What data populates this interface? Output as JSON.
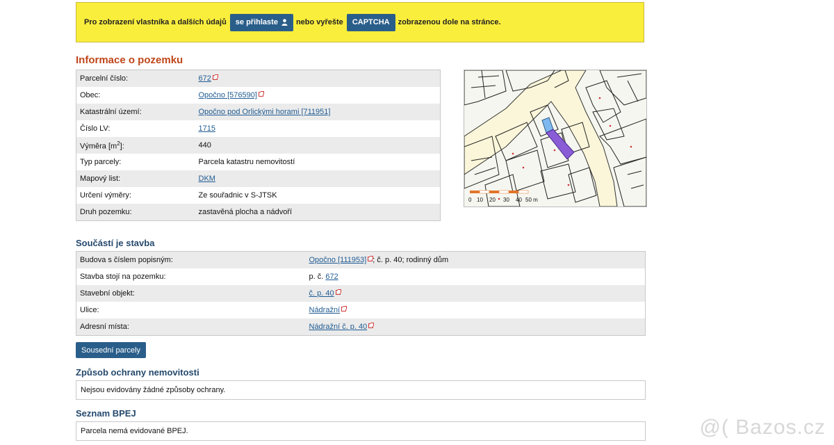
{
  "banner": {
    "text_before": "Pro zobrazení vlastníka a dalších údajů",
    "login_button": "se přihlaste",
    "text_middle": "nebo vyřešte",
    "captcha_button": "CAPTCHA",
    "text_after": "zobrazenou dole na stránce."
  },
  "parcel": {
    "title": "Informace o pozemku",
    "rows": [
      {
        "label": "Parcelní číslo:",
        "value": "672",
        "link": true,
        "ext": true
      },
      {
        "label": "Obec:",
        "value": "Opočno [576590]",
        "link": true,
        "ext": true
      },
      {
        "label": "Katastrální území:",
        "value": "Opočno pod Orlickými horami [711951]",
        "link": true,
        "ext": false
      },
      {
        "label": "Číslo LV:",
        "value": "1715",
        "link": true,
        "ext": false
      },
      {
        "label": "Výměra [m2]:",
        "value": "440",
        "link": false,
        "ext": false
      },
      {
        "label": "Typ parcely:",
        "value": "Parcela katastru nemovitostí",
        "link": false,
        "ext": false
      },
      {
        "label": "Mapový list:",
        "value": "DKM",
        "link": true,
        "ext": false
      },
      {
        "label": "Určení výměry:",
        "value": "Ze souřadnic v S-JTSK",
        "link": false,
        "ext": false
      },
      {
        "label": "Druh pozemku:",
        "value": "zastavěná plocha a nádvoří",
        "link": false,
        "ext": false
      }
    ],
    "area_label_base": "Výměra [m",
    "area_label_sup": "2",
    "area_label_tail": "]:"
  },
  "map": {
    "scale_labels": [
      "0",
      "10",
      "20",
      "30",
      "40",
      "50 m"
    ],
    "parcel_color": "#8a5cd6",
    "neighbor_color": "#7fb8ef"
  },
  "building": {
    "title": "Součástí je stavba",
    "rows": [
      {
        "label": "Budova s číslem popisným:",
        "link_text": "Opočno [111953]",
        "suffix": "; č. p. 40; rodinný dům",
        "prefix": ""
      },
      {
        "label": "Stavba stojí na pozemku:",
        "prefix": "p. č. ",
        "link_text": "672",
        "suffix": ""
      },
      {
        "label": "Stavební objekt:",
        "prefix": "",
        "link_text": "č. p. 40",
        "suffix": ""
      },
      {
        "label": "Ulice:",
        "prefix": "",
        "link_text": "Nádražní",
        "suffix": ""
      },
      {
        "label": "Adresní místa:",
        "prefix": "",
        "link_text": "Nádražní č. p. 40",
        "suffix": ""
      }
    ]
  },
  "neighbors_button": "Sousední parcely",
  "protection": {
    "title": "Způsob ochrany nemovitosti",
    "text": "Nejsou evidovány žádné způsoby ochrany."
  },
  "bpej": {
    "title": "Seznam BPEJ",
    "text": "Parcela nemá evidované BPEJ."
  },
  "watermark": "@( Bazos.cz"
}
